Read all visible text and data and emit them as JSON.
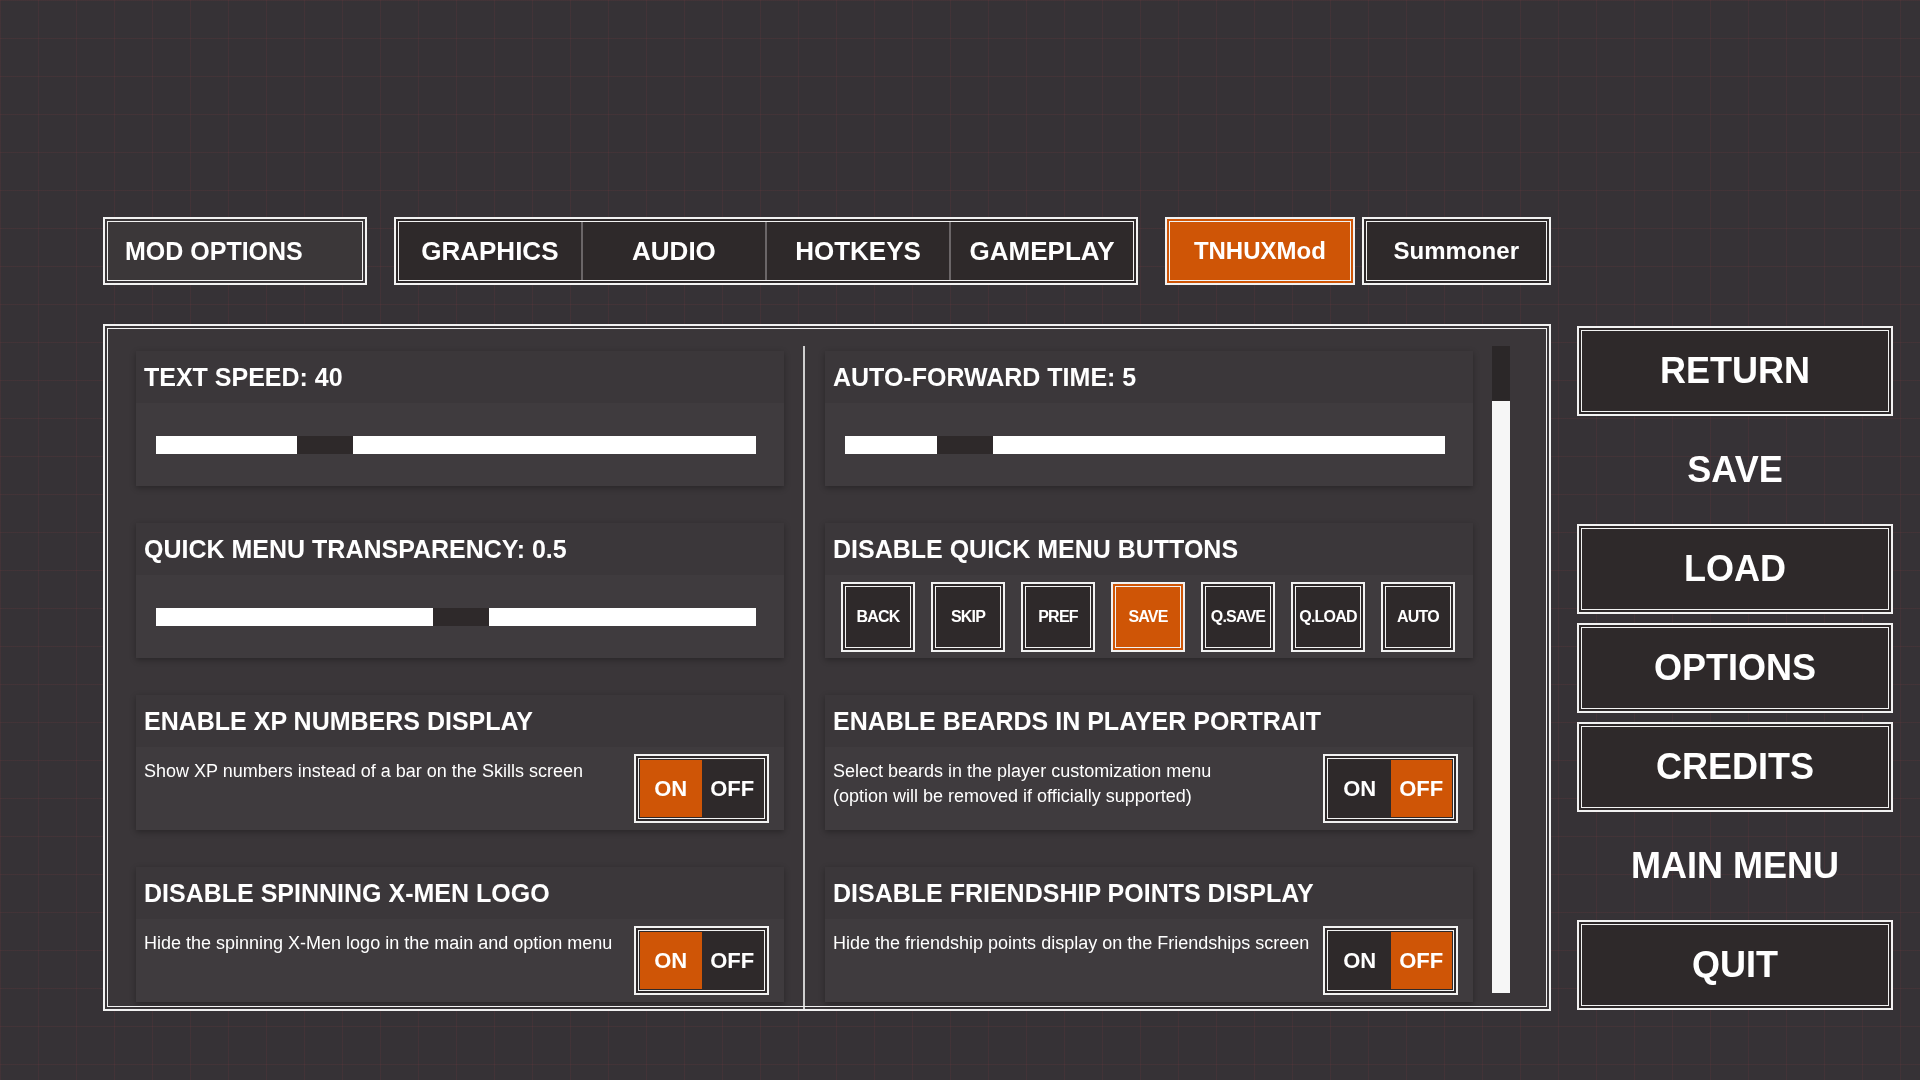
{
  "top_bar": {
    "title": "MOD OPTIONS",
    "tabs": [
      {
        "label": "GRAPHICS",
        "selected": false
      },
      {
        "label": "AUDIO",
        "selected": false
      },
      {
        "label": "HOTKEYS",
        "selected": false
      },
      {
        "label": "GAMEPLAY",
        "selected": false
      }
    ],
    "mod_tabs": [
      {
        "label": "TNHUXMod",
        "selected": true
      },
      {
        "label": "Summoner",
        "selected": false
      }
    ]
  },
  "left_column": [
    {
      "kind": "slider",
      "title": "TEXT SPEED: 40",
      "level": 0.26
    },
    {
      "kind": "slider",
      "title": "QUICK MENU TRANSPARENCY: 0.5",
      "level": 0.51
    },
    {
      "kind": "toggle",
      "title": "ENABLE XP NUMBERS DISPLAY",
      "description": "Show XP numbers instead of a bar on the Skills screen",
      "on": true,
      "on_label": "ON",
      "off_label": "OFF"
    },
    {
      "kind": "toggle",
      "title": "DISABLE SPINNING X-MEN LOGO",
      "description": "Hide the spinning X-Men logo in the main and option menu",
      "on": true,
      "on_label": "ON",
      "off_label": "OFF"
    }
  ],
  "right_column": [
    {
      "kind": "slider",
      "title": "AUTO-FORWARD TIME: 5",
      "level": 0.17
    },
    {
      "kind": "buttons",
      "title": "DISABLE QUICK MENU BUTTONS",
      "buttons": [
        {
          "label": "BACK",
          "selected": false
        },
        {
          "label": "SKIP",
          "selected": false
        },
        {
          "label": "PREF",
          "selected": false
        },
        {
          "label": "SAVE",
          "selected": true
        },
        {
          "label": "Q.SAVE",
          "selected": false
        },
        {
          "label": "Q.LOAD",
          "selected": false
        },
        {
          "label": "AUTO",
          "selected": false
        }
      ]
    },
    {
      "kind": "toggle",
      "title": "ENABLE BEARDS IN PLAYER PORTRAIT",
      "description": "Select beards in the player customization menu\n(option will be removed if officially supported)",
      "on": false,
      "on_label": "ON",
      "off_label": "OFF"
    },
    {
      "kind": "toggle",
      "title": "DISABLE FRIENDSHIP POINTS DISPLAY",
      "description": "Hide the friendship points display on the Friendships screen",
      "on": false,
      "on_label": "ON",
      "off_label": "OFF"
    }
  ],
  "side_menu": [
    {
      "label": "RETURN",
      "kind": "framed"
    },
    {
      "label": "SAVE",
      "kind": "plain"
    },
    {
      "label": "LOAD",
      "kind": "framed"
    },
    {
      "label": "OPTIONS",
      "kind": "framed"
    },
    {
      "label": "CREDITS",
      "kind": "framed"
    },
    {
      "label": "MAIN MENU",
      "kind": "plain"
    },
    {
      "label": "QUIT",
      "kind": "framed"
    }
  ]
}
